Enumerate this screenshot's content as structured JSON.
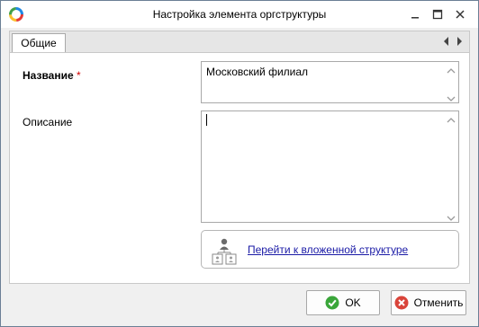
{
  "window": {
    "title": "Настройка элемента оргструктуры",
    "minimize_icon": "minimize-icon",
    "maximize_icon": "maximize-icon",
    "close_icon": "close-icon"
  },
  "tabs": [
    {
      "label": "Общие",
      "selected": true
    }
  ],
  "form": {
    "name_label": "Название",
    "required_marker": "*",
    "name_value": "Московский филиал",
    "description_label": "Описание",
    "description_value": ""
  },
  "link": {
    "text": "Перейти к вложенной структуре",
    "icon": "org-structure-icon"
  },
  "buttons": {
    "ok_label": "OK",
    "cancel_label": "Отменить"
  },
  "colors": {
    "required": "#d10000",
    "link": "#1a1aa6",
    "ok_icon": "#3aa63a",
    "cancel_icon": "#d9443a"
  }
}
